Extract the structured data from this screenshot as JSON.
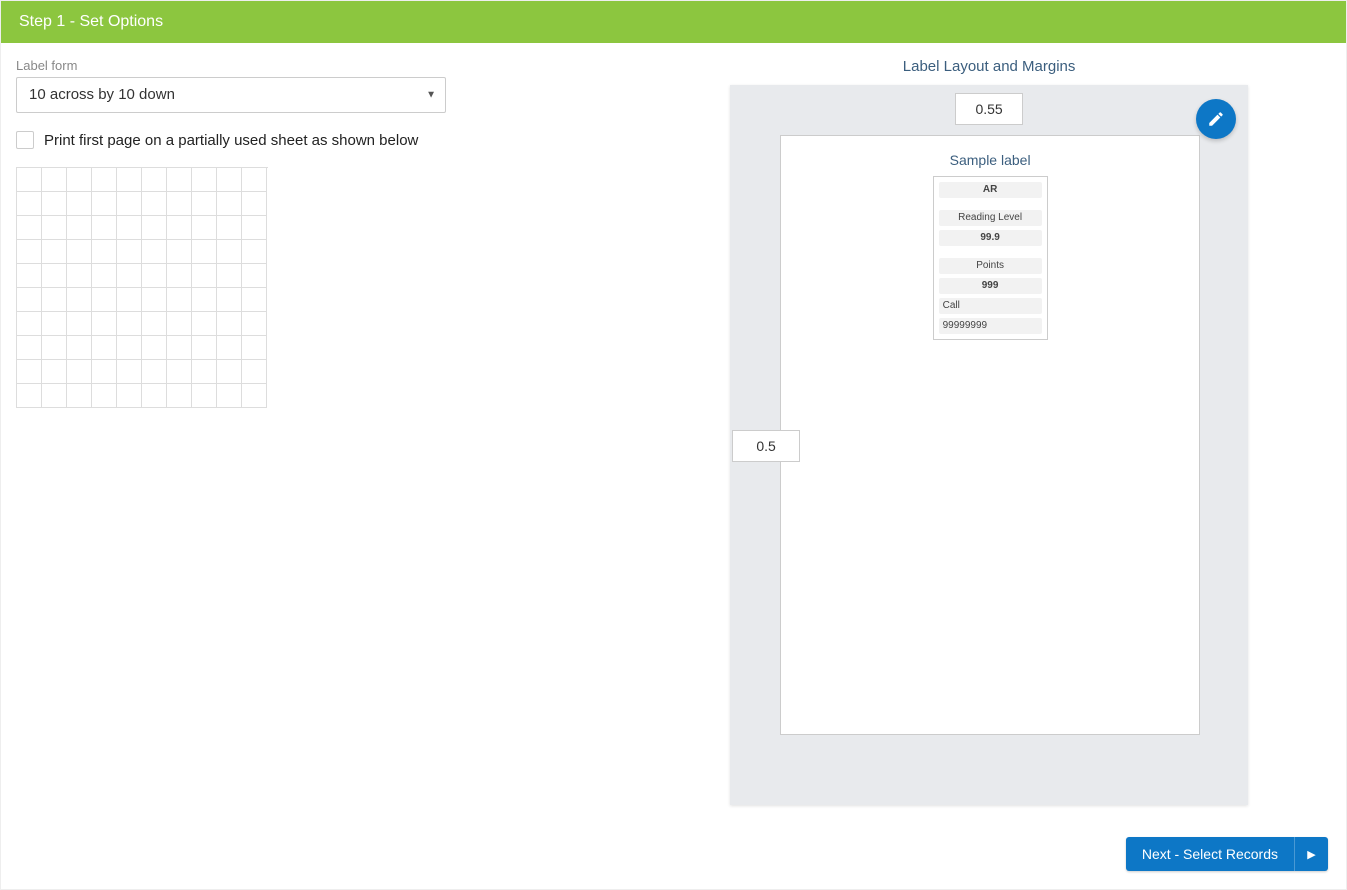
{
  "step": {
    "title": "Step 1 - Set Options"
  },
  "form": {
    "label_form_label": "Label form",
    "label_form_value": "10 across by 10 down",
    "partial_sheet_label": "Print first page on a partially used sheet as shown below"
  },
  "grid": {
    "cols": 10,
    "rows": 10
  },
  "layout": {
    "title": "Label Layout and Margins",
    "margin_top": "0.55",
    "margin_left": "0.5",
    "sample_title": "Sample label",
    "sample": {
      "section1": "AR",
      "reading_label": "Reading Level",
      "reading_value": "99.9",
      "points_label": "Points",
      "points_value": "999",
      "call_label": "Call",
      "call_value": "99999999"
    }
  },
  "footer": {
    "next_label": "Next - Select Records"
  },
  "icons": {
    "edit": "pencil-icon",
    "caret": "caret-down-icon",
    "arrow": "play-icon"
  }
}
